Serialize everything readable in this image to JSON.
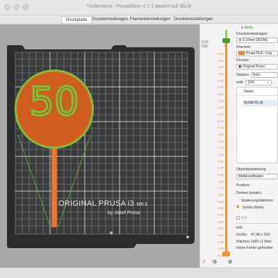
{
  "window": {
    "title": "*Unbenannt - PrusaSlicer-2.7.1 basiert auf Slic3r"
  },
  "tabs": [
    {
      "label": "Druckplatte",
      "active": true
    },
    {
      "label": "Druckeinstellungen",
      "active": false
    },
    {
      "label": "Filamenteinstellungen",
      "active": false
    },
    {
      "label": "Druckereinstellungen",
      "active": false
    }
  ],
  "scene": {
    "model_text": "50",
    "bed_brand": "ORIGINAL PRUSA i3",
    "bed_model": "MK3",
    "bed_credit": "by Josef Prusa",
    "colors": {
      "model_orange": "#e8702a",
      "model_green": "#6fc83a",
      "bed_dark": "#2c2c2e",
      "background": "#a7a9ab"
    }
  },
  "layer_slider": {
    "top_value": "3,10",
    "top_layer": "(16)",
    "ticks": [
      "3,10",
      "3,00",
      "2,90",
      "2,80",
      "2,70",
      "2,60",
      "2,50",
      "2,40",
      "2,30",
      "2,20",
      "2,10",
      "2,00",
      "1,90",
      "1,80",
      "1,70",
      "1,60",
      "1,50",
      "1,40",
      "1,30",
      "1,20",
      "1,10",
      "1,00",
      "0,90",
      "0,80",
      "0,70",
      "0,60",
      "0,50",
      "0,40",
      "0,30",
      "0,20",
      "0,10"
    ]
  },
  "right_panel": {
    "mode_label": "Einfa",
    "print_settings_label": "Druckeinstellungen:",
    "print_settings_value": "0.10mm DETAIL",
    "filament_label": "Filament:",
    "filament_value": "Prusa PLA - Cop",
    "printer_label": "Drucker:",
    "printer_value": "Original Prusa",
    "supports_label": "Stützen:",
    "supports_value": "Kein",
    "infill_label": "Infill:",
    "infill_value": "15%",
    "list_header": "Name",
    "object_name": "Schild 50.stl",
    "object_manip_label": "Objektbearbeitung",
    "coords_value": "Weltkoordinaten",
    "position_label": "Position:",
    "rotation_label": "Drehen (relativ):",
    "scale_label": "Skalierungsfaktoren",
    "size_label": "Größe (Welt):",
    "inch_label": "Zoll",
    "info_label": "Info",
    "size_info_label": "Größe:",
    "size_info_value": "97,98 x 203,",
    "facets_label": "Flächen:",
    "facets_value": "1992 (1 Wan",
    "errors_value": "Keine Fehler gefunden"
  }
}
